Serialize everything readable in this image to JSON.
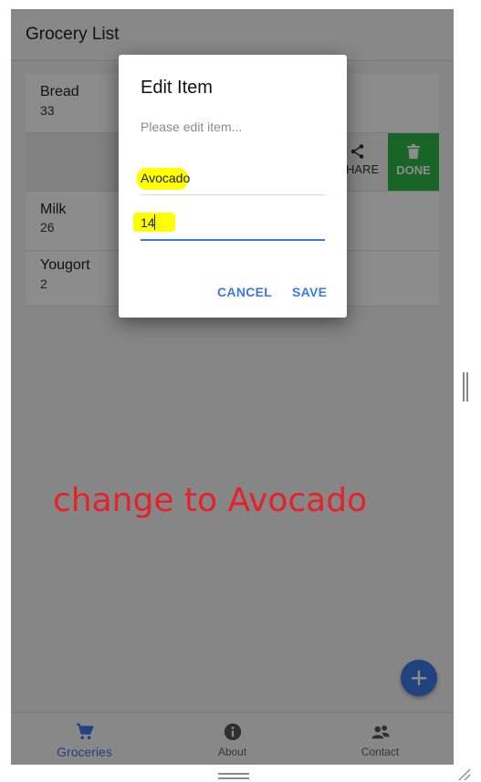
{
  "header": {
    "title": "Grocery List"
  },
  "list": {
    "items": [
      {
        "name": "Bread",
        "quantity": "33"
      },
      {
        "name": "Milk",
        "quantity": "26"
      },
      {
        "name": "Yougort",
        "quantity": "2"
      }
    ],
    "slide_actions": {
      "share_label": "HARE",
      "done_label": "DONE"
    }
  },
  "dialog": {
    "title": "Edit Item",
    "message": "Please edit item...",
    "name_value": "Avocado",
    "quantity_value": "14",
    "cancel_label": "CANCEL",
    "save_label": "SAVE"
  },
  "tabs": [
    {
      "label": "Groceries",
      "icon": "cart-icon",
      "active": true
    },
    {
      "label": "About",
      "icon": "info-icon",
      "active": false
    },
    {
      "label": "Contact",
      "icon": "contact-icon",
      "active": false
    }
  ],
  "fab": {
    "icon": "plus-icon"
  },
  "annotation": {
    "text": "change to Avocado",
    "color": "#e8202a"
  },
  "colors": {
    "accent": "#3b78e7",
    "done": "#2eb84a",
    "highlight": "#ffff00"
  }
}
